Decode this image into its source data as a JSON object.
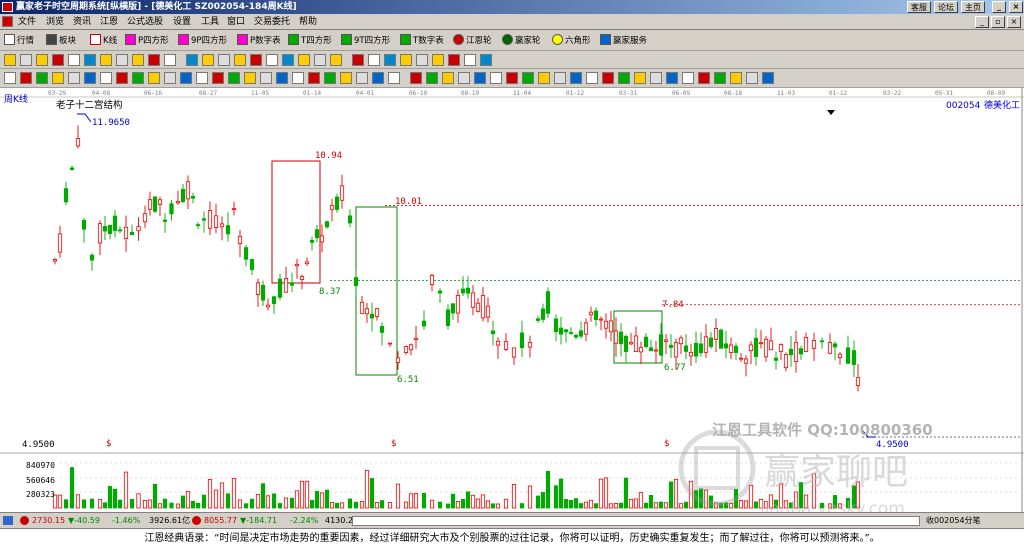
{
  "titlebar": {
    "title": "赢家老子时空周期系统[纵横版] - [德美化工  SZ002054-184周K线]",
    "links": [
      "客服",
      "论坛",
      "主页"
    ]
  },
  "menu": [
    "文件",
    "浏览",
    "资讯",
    "江恩",
    "公式选股",
    "设置",
    "工具",
    "窗口",
    "交易委托",
    "帮助"
  ],
  "toolbar1": [
    "行情",
    "板块",
    "K线",
    "P四方形",
    "9P四方形",
    "P数字表",
    "T四方形",
    "9T四方形",
    "T数字表",
    "江恩轮",
    "赢家轮",
    "六角形",
    "赢家服务"
  ],
  "chart": {
    "period_label": "周K线",
    "indicator_title": "老子十二宫结构",
    "stock_code": "002054",
    "stock_name": "德美化工",
    "date_ticks": [
      "03-29",
      "04-08",
      "06-16",
      "08-27",
      "11-05",
      "01-14",
      "04-01",
      "06-10",
      "08-19",
      "11-04",
      "01-12",
      "03-31",
      "06-09",
      "08-18",
      "11-03",
      "01-12",
      "03-22",
      "05-31",
      "08-09"
    ],
    "annotations": [
      "11.9650",
      "10.94",
      "10.01",
      "8.37",
      "7.84",
      "6.77",
      "6.51",
      "4.9500"
    ],
    "price_left_label": "4.9500",
    "dollar_marks": [
      "$",
      "$",
      "$"
    ],
    "volume_axis": [
      "840970",
      "560646",
      "280323"
    ],
    "watermark1": "江恩工具软件  QQ:100800360",
    "watermark2": "赢家聊吧",
    "watermark3": "liaoba.yesky.com"
  },
  "chart_data": {
    "type": "candlestick",
    "title": "老子十二宫结构",
    "series": [
      {
        "name": "德美化工 002054 周K线"
      }
    ],
    "marked_levels": [
      11.965,
      10.94,
      10.01,
      8.37,
      7.84,
      6.77,
      6.51,
      4.95
    ],
    "volume_ticks": [
      840970,
      560646,
      280323
    ]
  },
  "statusbar": {
    "sh_index": "2730.15",
    "sh_change": "▼-40.59",
    "sh_pct": "-1.46%",
    "sh_amount": "3926.61亿",
    "sz_index": "8055.77",
    "sz_change": "▼-184.71",
    "sz_pct": "-2.24%",
    "sz_amount": "4130.2",
    "bars_label": "收002054分笔"
  },
  "footer_quote": "江恩经典语录：“时间是决定市场走势的重要因素，经过详细研究大市及个别股票的过往记录，你将可以证明，历史确实重复发生；而了解过往，你将可以预测将来。”。"
}
